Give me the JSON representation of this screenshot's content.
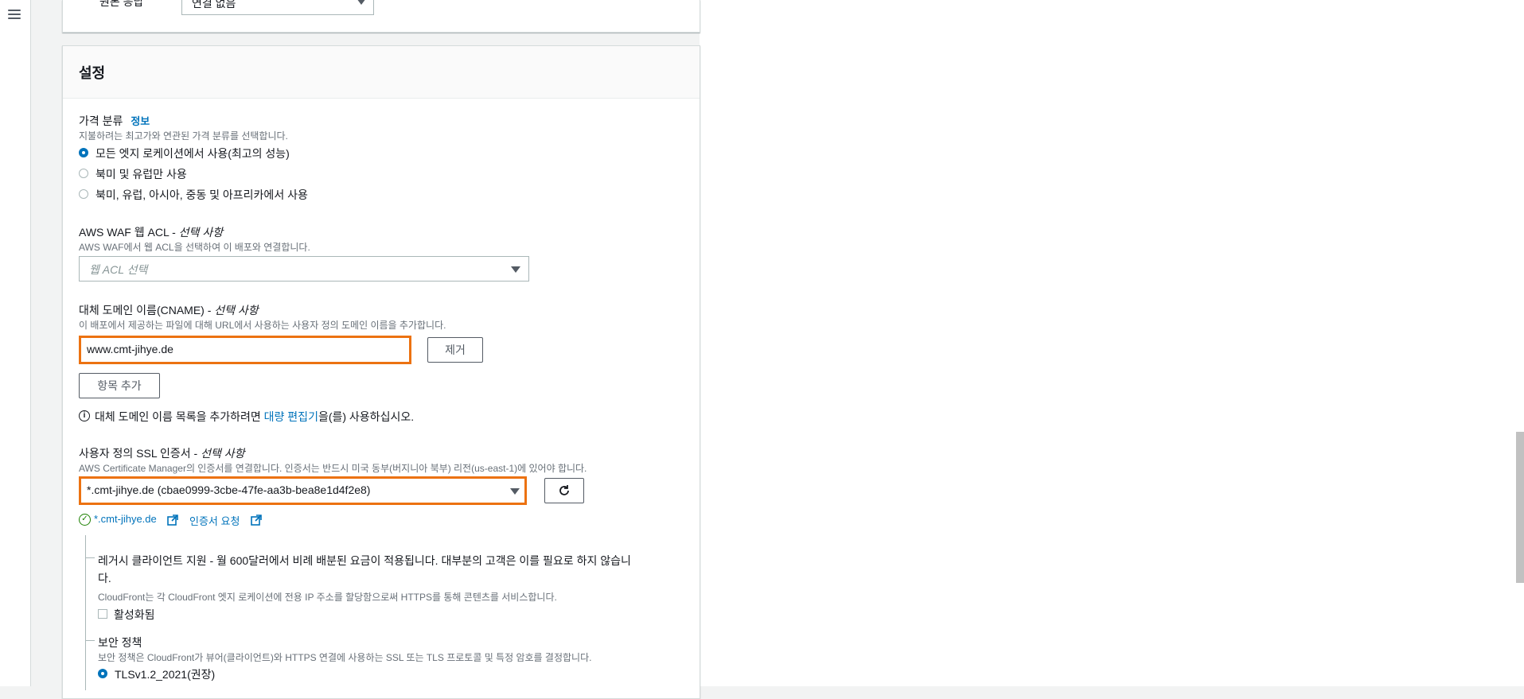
{
  "nav": {
    "menu_icon": "hamburger-menu-icon"
  },
  "prev_panel": {
    "label": "원본 응답",
    "select_value": "연결 없음"
  },
  "settings": {
    "title": "설정",
    "price_class": {
      "label": "가격 분류",
      "info_link": "정보",
      "description": "지불하려는 최고가와 연관된 가격 분류를 선택합니다.",
      "options": [
        {
          "label": "모든 엣지 로케이션에서 사용(최고의 성능)",
          "selected": true
        },
        {
          "label": "북미 및 유럽만 사용",
          "selected": false
        },
        {
          "label": "북미, 유럽, 아시아, 중동 및 아프리카에서 사용",
          "selected": false
        }
      ]
    },
    "waf": {
      "label": "AWS WAF 웹 ACL - ",
      "optional": "선택 사항",
      "description": "AWS WAF에서 웹 ACL을 선택하여 이 배포와 연결합니다.",
      "placeholder": "웹 ACL 선택"
    },
    "cname": {
      "label": "대체 도메인 이름(CNAME) - ",
      "optional": "선택 사항",
      "description": "이 배포에서 제공하는 파일에 대해 URL에서 사용하는 사용자 정의 도메인 이름을 추가합니다.",
      "value": "www.cmt-jihye.de",
      "remove_label": "제거",
      "add_label": "항목 추가",
      "bulk_note_before": "대체 도메인 이름 목록을 추가하려면 ",
      "bulk_link": "대량 편집기",
      "bulk_note_after": "을(를) 사용하십시오."
    },
    "ssl": {
      "label": "사용자 정의 SSL 인증서 - ",
      "optional": "선택 사항",
      "description_before": "AWS Certificate Manager",
      "description_after": "의 인증서를 연결합니다. 인증서는 반드시 미국 동부(버지니아 북부) 리전(us-east-1)에 있어야 합니다.",
      "value": "*.cmt-jihye.de (cbae0999-3cbe-47fe-aa3b-bea8e1d4f2e8)",
      "cert_link": "*.cmt-jihye.de",
      "request_link": "인증서 요청"
    },
    "legacy": {
      "title_line1": "레거시 클라이언트 지원 - 월 600달러에서 비례 배분된 요금이 적용됩니다. 대부분의 고객은 이를 필요로 하지 않습니",
      "title_line2": "다.",
      "description": "CloudFront는 각 CloudFront 엣지 로케이션에 전용 IP 주소를 할당함으로써 HTTPS를 통해 콘텐츠를 서비스합니다.",
      "checkbox_label": "활성화됨",
      "checked": false
    },
    "security_policy": {
      "label": "보안 정책",
      "description": "보안 정책은 CloudFront가 뷰어(클라이언트)와 HTTPS 연결에 사용하는 SSL 또는 TLS 프로토콜 및 특정 암호를 결정합니다.",
      "option": "TLSv1.2_2021(권장)",
      "selected": true
    }
  },
  "colors": {
    "accent": "#0073bb",
    "highlight": "#ec7211",
    "success": "#1d8102"
  }
}
